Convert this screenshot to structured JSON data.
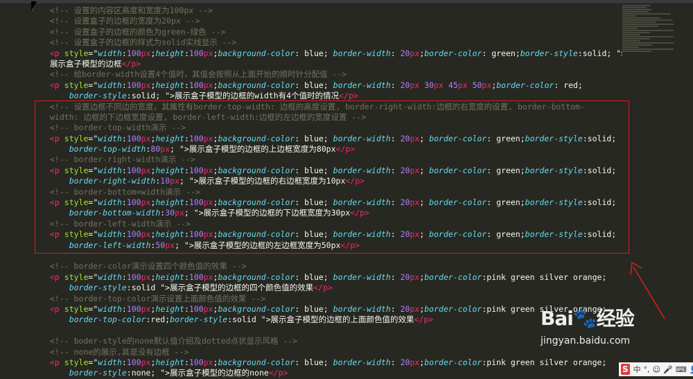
{
  "editor": {
    "lines": [
      [
        {
          "c": "cm",
          "t": "<!-- 设置的内容区高度和宽度为100px -->"
        }
      ],
      [
        {
          "c": "cm",
          "t": "<!-- 设置盒子的边框的宽度为20px -->"
        }
      ],
      [
        {
          "c": "cm",
          "t": "<!-- 设置盒子的边框的颜色为green-绿色 -->"
        }
      ],
      [
        {
          "c": "cm",
          "t": "<!-- 设置盒子的边框的样式为solid实线显示 -->"
        }
      ],
      [
        {
          "c": "tg",
          "t": "<p "
        },
        {
          "c": "at",
          "t": "style"
        },
        {
          "c": "tx",
          "t": "=\""
        },
        {
          "c": "ak",
          "t": "width"
        },
        {
          "c": "tx",
          "t": ":"
        },
        {
          "c": "nm",
          "t": "100"
        },
        {
          "c": "un",
          "t": "px"
        },
        {
          "c": "tx",
          "t": ";"
        },
        {
          "c": "ak",
          "t": "height"
        },
        {
          "c": "tx",
          "t": ":"
        },
        {
          "c": "nm",
          "t": "100"
        },
        {
          "c": "un",
          "t": "px"
        },
        {
          "c": "tx",
          "t": ";"
        },
        {
          "c": "ak",
          "t": "background-color"
        },
        {
          "c": "tx",
          "t": ": blue; "
        },
        {
          "c": "ak",
          "t": "border-width"
        },
        {
          "c": "tx",
          "t": ": "
        },
        {
          "c": "nm",
          "t": "20"
        },
        {
          "c": "un",
          "t": "px"
        },
        {
          "c": "tx",
          "t": ";"
        },
        {
          "c": "ak",
          "t": "border-color"
        },
        {
          "c": "tx",
          "t": ": green;"
        },
        {
          "c": "ak",
          "t": "border-style"
        },
        {
          "c": "tx",
          "t": ":solid; \">"
        }
      ],
      [
        {
          "c": "tx",
          "t": "展示盒子模型的边框"
        },
        {
          "c": "tg",
          "t": "</p>"
        }
      ],
      [
        {
          "c": "cm",
          "t": "<!-- 给border-width设置4个值时，其值会按照从上面开始的顺时针分配值 -->"
        }
      ],
      [
        {
          "c": "tg",
          "t": "<p "
        },
        {
          "c": "at",
          "t": "style"
        },
        {
          "c": "tx",
          "t": "=\""
        },
        {
          "c": "ak",
          "t": "width"
        },
        {
          "c": "tx",
          "t": ":"
        },
        {
          "c": "nm",
          "t": "100"
        },
        {
          "c": "un",
          "t": "px"
        },
        {
          "c": "tx",
          "t": ";"
        },
        {
          "c": "ak",
          "t": "height"
        },
        {
          "c": "tx",
          "t": ":"
        },
        {
          "c": "nm",
          "t": "100"
        },
        {
          "c": "un",
          "t": "px"
        },
        {
          "c": "tx",
          "t": ";"
        },
        {
          "c": "ak",
          "t": "background-color"
        },
        {
          "c": "tx",
          "t": ": blue; "
        },
        {
          "c": "ak",
          "t": "border-width"
        },
        {
          "c": "tx",
          "t": ": "
        },
        {
          "c": "nm",
          "t": "20"
        },
        {
          "c": "un",
          "t": "px"
        },
        {
          "c": "tx",
          "t": " "
        },
        {
          "c": "nm",
          "t": "30"
        },
        {
          "c": "un",
          "t": "px"
        },
        {
          "c": "tx",
          "t": " "
        },
        {
          "c": "nm",
          "t": "45"
        },
        {
          "c": "un",
          "t": "px"
        },
        {
          "c": "tx",
          "t": " "
        },
        {
          "c": "nm",
          "t": "50"
        },
        {
          "c": "un",
          "t": "px"
        },
        {
          "c": "tx",
          "t": ";"
        },
        {
          "c": "ak",
          "t": "border-color"
        },
        {
          "c": "tx",
          "t": ": red;"
        }
      ],
      [
        {
          "c": "tx",
          "t": "    "
        },
        {
          "c": "ak",
          "t": "border-style"
        },
        {
          "c": "tx",
          "t": ":solid; \">展示盒子模型的边框的width有4个值时的情况"
        },
        {
          "c": "tg",
          "t": "</p>"
        }
      ],
      [
        {
          "c": "cm",
          "t": "<!-- 设置边框不同边的宽度，其属性有border-top-width: 边框的高度设置, border-right-width:边框的右宽度的设置, border-bottom-"
        }
      ],
      [
        {
          "c": "cm",
          "t": "width: 边框的下边框宽度设置, border-left-width:边框的左边框的宽度设置 -->"
        }
      ],
      [
        {
          "c": "cm",
          "t": "<!-- border-top-width演示 -->"
        }
      ],
      [
        {
          "c": "tg",
          "t": "<p "
        },
        {
          "c": "at",
          "t": "style"
        },
        {
          "c": "tx",
          "t": "=\""
        },
        {
          "c": "ak",
          "t": "width"
        },
        {
          "c": "tx",
          "t": ":"
        },
        {
          "c": "nm",
          "t": "100"
        },
        {
          "c": "un",
          "t": "px"
        },
        {
          "c": "tx",
          "t": ";"
        },
        {
          "c": "ak",
          "t": "height"
        },
        {
          "c": "tx",
          "t": ":"
        },
        {
          "c": "nm",
          "t": "100"
        },
        {
          "c": "un",
          "t": "px"
        },
        {
          "c": "tx",
          "t": ";"
        },
        {
          "c": "ak",
          "t": "background-color"
        },
        {
          "c": "tx",
          "t": ": blue; "
        },
        {
          "c": "ak",
          "t": "border-width"
        },
        {
          "c": "tx",
          "t": ": "
        },
        {
          "c": "nm",
          "t": "20"
        },
        {
          "c": "un",
          "t": "px"
        },
        {
          "c": "tx",
          "t": "; "
        },
        {
          "c": "ak",
          "t": "border-color"
        },
        {
          "c": "tx",
          "t": ": green;"
        },
        {
          "c": "ak",
          "t": "border-style"
        },
        {
          "c": "tx",
          "t": ":solid;"
        }
      ],
      [
        {
          "c": "tx",
          "t": "    "
        },
        {
          "c": "ak",
          "t": "border-top-width"
        },
        {
          "c": "tx",
          "t": ":"
        },
        {
          "c": "nm",
          "t": "80"
        },
        {
          "c": "un",
          "t": "px"
        },
        {
          "c": "tx",
          "t": "; \">展示盒子模型的边框的上边框宽度为80px"
        },
        {
          "c": "tg",
          "t": "</p>"
        }
      ],
      [
        {
          "c": "cm",
          "t": "<!-- border-right-width演示 -->"
        }
      ],
      [
        {
          "c": "tg",
          "t": "<p "
        },
        {
          "c": "at",
          "t": "style"
        },
        {
          "c": "tx",
          "t": "=\""
        },
        {
          "c": "ak",
          "t": "width"
        },
        {
          "c": "tx",
          "t": ":"
        },
        {
          "c": "nm",
          "t": "100"
        },
        {
          "c": "un",
          "t": "px"
        },
        {
          "c": "tx",
          "t": ";"
        },
        {
          "c": "ak",
          "t": "height"
        },
        {
          "c": "tx",
          "t": ":"
        },
        {
          "c": "nm",
          "t": "100"
        },
        {
          "c": "un",
          "t": "px"
        },
        {
          "c": "tx",
          "t": ";"
        },
        {
          "c": "ak",
          "t": "background-color"
        },
        {
          "c": "tx",
          "t": ": blue; "
        },
        {
          "c": "ak",
          "t": "border-width"
        },
        {
          "c": "tx",
          "t": ": "
        },
        {
          "c": "nm",
          "t": "20"
        },
        {
          "c": "un",
          "t": "px"
        },
        {
          "c": "tx",
          "t": "; "
        },
        {
          "c": "ak",
          "t": "border-color"
        },
        {
          "c": "tx",
          "t": ": green;"
        },
        {
          "c": "ak",
          "t": "border-style"
        },
        {
          "c": "tx",
          "t": ":solid;"
        }
      ],
      [
        {
          "c": "tx",
          "t": "    "
        },
        {
          "c": "ak",
          "t": "border-right-width"
        },
        {
          "c": "tx",
          "t": ":"
        },
        {
          "c": "nm",
          "t": "10"
        },
        {
          "c": "un",
          "t": "px"
        },
        {
          "c": "tx",
          "t": "; \">展示盒子模型的边框的右边框宽度为10px"
        },
        {
          "c": "tg",
          "t": "</p>"
        }
      ],
      [
        {
          "c": "cm",
          "t": "<!-- border-bottom=width演示 -->"
        }
      ],
      [
        {
          "c": "tg",
          "t": "<p "
        },
        {
          "c": "at",
          "t": "style"
        },
        {
          "c": "tx",
          "t": "=\""
        },
        {
          "c": "ak",
          "t": "width"
        },
        {
          "c": "tx",
          "t": ":"
        },
        {
          "c": "nm",
          "t": "100"
        },
        {
          "c": "un",
          "t": "px"
        },
        {
          "c": "tx",
          "t": ";"
        },
        {
          "c": "ak",
          "t": "height"
        },
        {
          "c": "tx",
          "t": ":"
        },
        {
          "c": "nm",
          "t": "100"
        },
        {
          "c": "un",
          "t": "px"
        },
        {
          "c": "tx",
          "t": ";"
        },
        {
          "c": "ak",
          "t": "background-color"
        },
        {
          "c": "tx",
          "t": ": blue; "
        },
        {
          "c": "ak",
          "t": "border-width"
        },
        {
          "c": "tx",
          "t": ": "
        },
        {
          "c": "nm",
          "t": "20"
        },
        {
          "c": "un",
          "t": "px"
        },
        {
          "c": "tx",
          "t": "; "
        },
        {
          "c": "ak",
          "t": "border-color"
        },
        {
          "c": "tx",
          "t": ": green;"
        },
        {
          "c": "ak",
          "t": "border-style"
        },
        {
          "c": "tx",
          "t": ":solid;"
        }
      ],
      [
        {
          "c": "tx",
          "t": "    "
        },
        {
          "c": "ak",
          "t": "border-bottom-width"
        },
        {
          "c": "tx",
          "t": ":"
        },
        {
          "c": "nm",
          "t": "30"
        },
        {
          "c": "un",
          "t": "px"
        },
        {
          "c": "tx",
          "t": "; \">展示盒子模型的边框的下边框宽度为30px"
        },
        {
          "c": "tg",
          "t": "</p>"
        }
      ],
      [
        {
          "c": "cm",
          "t": "<!-- border-left-width演示 -->"
        }
      ],
      [
        {
          "c": "tg",
          "t": "<p "
        },
        {
          "c": "at",
          "t": "style"
        },
        {
          "c": "tx",
          "t": "=\""
        },
        {
          "c": "ak",
          "t": "width"
        },
        {
          "c": "tx",
          "t": ":"
        },
        {
          "c": "nm",
          "t": "100"
        },
        {
          "c": "un",
          "t": "px"
        },
        {
          "c": "tx",
          "t": ";"
        },
        {
          "c": "ak",
          "t": "height"
        },
        {
          "c": "tx",
          "t": ":"
        },
        {
          "c": "nm",
          "t": "100"
        },
        {
          "c": "un",
          "t": "px"
        },
        {
          "c": "tx",
          "t": ";"
        },
        {
          "c": "ak",
          "t": "background-color"
        },
        {
          "c": "tx",
          "t": ": blue; "
        },
        {
          "c": "ak",
          "t": "border-width"
        },
        {
          "c": "tx",
          "t": ": "
        },
        {
          "c": "nm",
          "t": "20"
        },
        {
          "c": "un",
          "t": "px"
        },
        {
          "c": "tx",
          "t": "; "
        },
        {
          "c": "ak",
          "t": "border-color"
        },
        {
          "c": "tx",
          "t": ": green;"
        },
        {
          "c": "ak",
          "t": "border-style"
        },
        {
          "c": "tx",
          "t": ":solid;"
        }
      ],
      [
        {
          "c": "tx",
          "t": "    "
        },
        {
          "c": "ak",
          "t": "border-left-width"
        },
        {
          "c": "tx",
          "t": ":"
        },
        {
          "c": "nm",
          "t": "50"
        },
        {
          "c": "un",
          "t": "px"
        },
        {
          "c": "tx",
          "t": "; \">展示盒子模型的边框的左边框宽度为50px"
        },
        {
          "c": "tg",
          "t": "</p>"
        }
      ],
      [],
      [
        {
          "c": "cm",
          "t": "<!-- border-color演示设置四个颜色值的效果 -->"
        }
      ],
      [
        {
          "c": "tg",
          "t": "<p "
        },
        {
          "c": "at",
          "t": "style"
        },
        {
          "c": "tx",
          "t": "=\""
        },
        {
          "c": "ak",
          "t": "width"
        },
        {
          "c": "tx",
          "t": ":"
        },
        {
          "c": "nm",
          "t": "100"
        },
        {
          "c": "un",
          "t": "px"
        },
        {
          "c": "tx",
          "t": ";"
        },
        {
          "c": "ak",
          "t": "height"
        },
        {
          "c": "tx",
          "t": ":"
        },
        {
          "c": "nm",
          "t": "100"
        },
        {
          "c": "un",
          "t": "px"
        },
        {
          "c": "tx",
          "t": ";"
        },
        {
          "c": "ak",
          "t": "background-color"
        },
        {
          "c": "tx",
          "t": ": blue; "
        },
        {
          "c": "ak",
          "t": "border-width"
        },
        {
          "c": "tx",
          "t": ": "
        },
        {
          "c": "nm",
          "t": "20"
        },
        {
          "c": "un",
          "t": "px"
        },
        {
          "c": "tx",
          "t": ";"
        },
        {
          "c": "ak",
          "t": "border-color"
        },
        {
          "c": "tx",
          "t": ":pink green silver orange;"
        }
      ],
      [
        {
          "c": "tx",
          "t": "    "
        },
        {
          "c": "ak",
          "t": "border-style"
        },
        {
          "c": "tx",
          "t": ":solid \">展示盒子模型的边框的四个颜色值的效果"
        },
        {
          "c": "tg",
          "t": "</p>"
        }
      ],
      [
        {
          "c": "cm",
          "t": "<!-- border-top-color演示设置上面颜色值的效果 -->"
        }
      ],
      [
        {
          "c": "tg",
          "t": "<p "
        },
        {
          "c": "at",
          "t": "style"
        },
        {
          "c": "tx",
          "t": "=\""
        },
        {
          "c": "ak",
          "t": "width"
        },
        {
          "c": "tx",
          "t": ":"
        },
        {
          "c": "nm",
          "t": "100"
        },
        {
          "c": "un",
          "t": "px"
        },
        {
          "c": "tx",
          "t": ";"
        },
        {
          "c": "ak",
          "t": "height"
        },
        {
          "c": "tx",
          "t": ":"
        },
        {
          "c": "nm",
          "t": "100"
        },
        {
          "c": "un",
          "t": "px"
        },
        {
          "c": "tx",
          "t": ";"
        },
        {
          "c": "ak",
          "t": "background-color"
        },
        {
          "c": "tx",
          "t": ": blue; "
        },
        {
          "c": "ak",
          "t": "border-width"
        },
        {
          "c": "tx",
          "t": ": "
        },
        {
          "c": "nm",
          "t": "20"
        },
        {
          "c": "un",
          "t": "px"
        },
        {
          "c": "tx",
          "t": ";"
        },
        {
          "c": "ak",
          "t": "border-color"
        },
        {
          "c": "tx",
          "t": ":pink green silver orange;"
        }
      ],
      [
        {
          "c": "tx",
          "t": "    "
        },
        {
          "c": "ak",
          "t": "border-top-color"
        },
        {
          "c": "tx",
          "t": ":red;"
        },
        {
          "c": "ak",
          "t": "border-style"
        },
        {
          "c": "tx",
          "t": ":solid \">展示盒子模型的边框的上面颜色值的效果"
        },
        {
          "c": "tg",
          "t": "</p>"
        }
      ],
      [],
      [
        {
          "c": "cm",
          "t": "<!-- boder-style的none默认值介绍及dotted点状显示风格 -->"
        }
      ],
      [
        {
          "c": "cm",
          "t": "<!-- none的展示,其是没有边框 -->"
        }
      ],
      [
        {
          "c": "tg",
          "t": "<p "
        },
        {
          "c": "at",
          "t": "style"
        },
        {
          "c": "tx",
          "t": "=\""
        },
        {
          "c": "ak",
          "t": "width"
        },
        {
          "c": "tx",
          "t": ":"
        },
        {
          "c": "nm",
          "t": "100"
        },
        {
          "c": "un",
          "t": "px"
        },
        {
          "c": "tx",
          "t": ";"
        },
        {
          "c": "ak",
          "t": "height"
        },
        {
          "c": "tx",
          "t": ":"
        },
        {
          "c": "nm",
          "t": "100"
        },
        {
          "c": "un",
          "t": "px"
        },
        {
          "c": "tx",
          "t": ";"
        },
        {
          "c": "ak",
          "t": "background-color"
        },
        {
          "c": "tx",
          "t": ": blue; "
        },
        {
          "c": "ak",
          "t": "border-width"
        },
        {
          "c": "tx",
          "t": ": "
        },
        {
          "c": "nm",
          "t": "20"
        },
        {
          "c": "un",
          "t": "px"
        },
        {
          "c": "tx",
          "t": ";"
        },
        {
          "c": "ak",
          "t": "border-color"
        },
        {
          "c": "tx",
          "t": ":pink green silver orange;"
        }
      ],
      [
        {
          "c": "tx",
          "t": "    "
        },
        {
          "c": "ak",
          "t": "border-style"
        },
        {
          "c": "tx",
          "t": ":none; \">展示盒子模型的边框的none"
        },
        {
          "c": "tg",
          "t": "</p>"
        }
      ]
    ]
  },
  "watermark": {
    "logo": "Bai🐾经验",
    "url": "jingyan.baidu.com"
  },
  "ime": {
    "logo": "S",
    "items": [
      "中",
      "°,",
      "☺",
      "🎤",
      "⌨",
      "👤",
      "👕",
      "⊞"
    ]
  },
  "colors": {
    "background": "#272822",
    "highlight_box": "#d02020",
    "arrow": "#d02020"
  }
}
